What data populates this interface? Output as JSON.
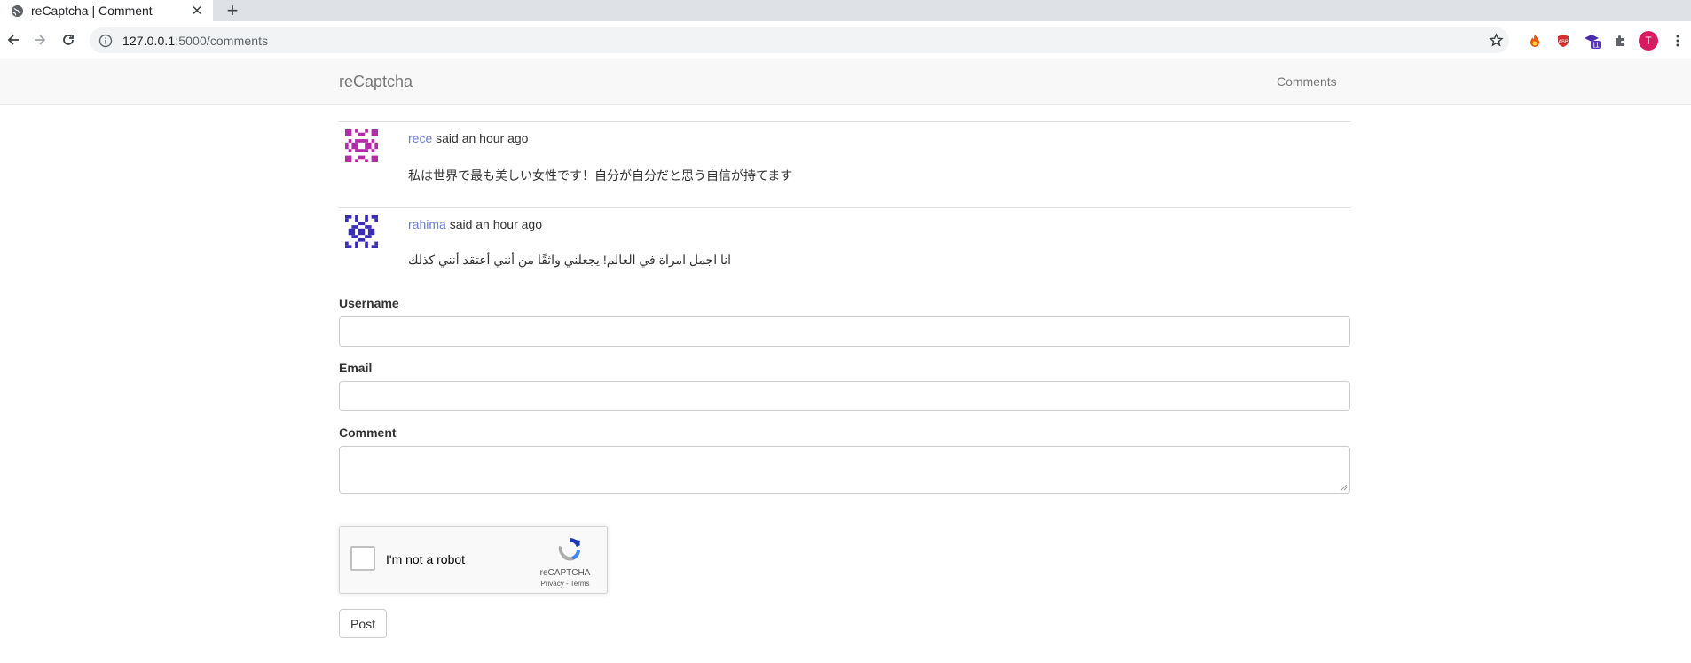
{
  "browser": {
    "tab_title": "reCaptcha | Comment",
    "url_host": "127.0.0.1",
    "url_path": ":5000/comments",
    "extension_badge": "11",
    "profile_initial": "T"
  },
  "navbar": {
    "brand": "reCaptcha",
    "link": "Comments"
  },
  "comments": [
    {
      "username": "rece",
      "said": "said",
      "time": "an hour ago",
      "text": "私は世界で最も美しい女性です！自分が自分だと思う自信が持てます",
      "avatar_color": "#b52aa8"
    },
    {
      "username": "rahima",
      "said": "said",
      "time": "an hour ago",
      "text": "انا اجمل امراة في العالم! يجعلني واثقًا من أنني أعتقد أنني كذلك",
      "avatar_color": "#3b2db8"
    }
  ],
  "form": {
    "username_label": "Username",
    "email_label": "Email",
    "comment_label": "Comment",
    "submit_label": "Post"
  },
  "recaptcha": {
    "checkbox_label": "I'm not a robot",
    "brand": "reCAPTCHA",
    "links": "Privacy - Terms"
  },
  "colors": {
    "link": "#6c7bd7",
    "navbar_bg": "#f8f8f8"
  }
}
